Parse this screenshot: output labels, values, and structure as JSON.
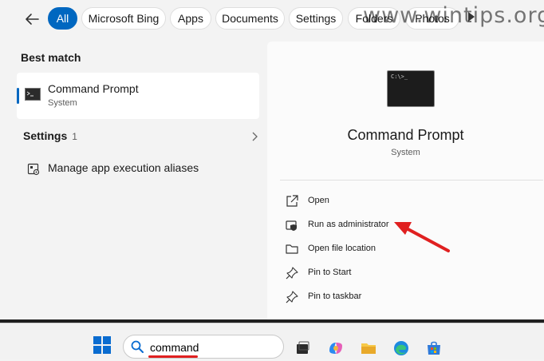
{
  "filters": {
    "chips": [
      "All",
      "Microsoft Bing",
      "Apps",
      "Documents",
      "Settings",
      "Folders",
      "Photos"
    ],
    "active": "All"
  },
  "best_match": {
    "heading": "Best match",
    "title": "Command Prompt",
    "subtitle": "System"
  },
  "settings_section": {
    "heading": "Settings",
    "count": "1",
    "item": "Manage app execution aliases"
  },
  "detail": {
    "prompt_glyph": "C:\\>_",
    "title": "Command Prompt",
    "subtitle": "System",
    "actions": [
      "Open",
      "Run as administrator",
      "Open file location",
      "Pin to Start",
      "Pin to taskbar"
    ]
  },
  "taskbar": {
    "search_text": "command",
    "icons": [
      "start-icon",
      "search-icon",
      "task-view-icon",
      "copilot-icon",
      "file-explorer-icon",
      "edge-icon",
      "store-icon"
    ]
  },
  "watermark": "www.wintips.org",
  "colors": {
    "accent": "#0067c0",
    "arrow": "#e02020"
  }
}
